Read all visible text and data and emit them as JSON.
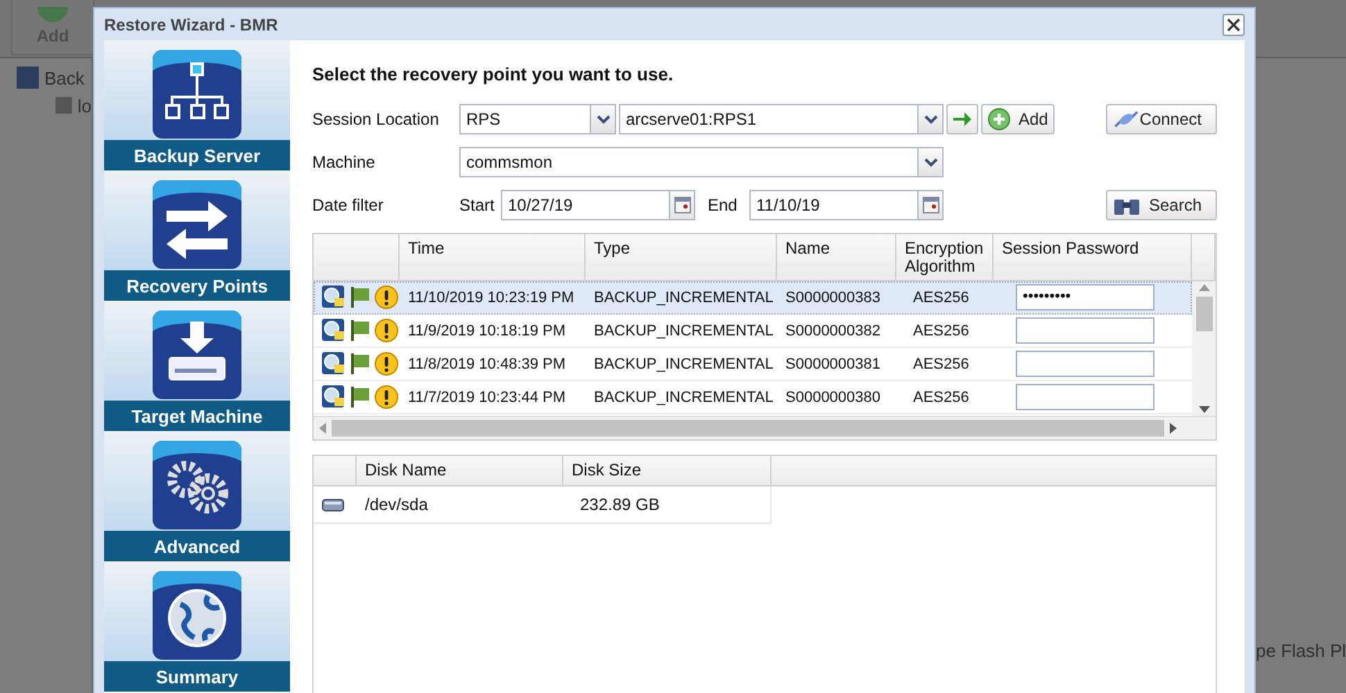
{
  "background": {
    "toolbar_button": "Add",
    "tree": [
      {
        "label": "Back",
        "children": [
          {
            "label": "lo"
          }
        ]
      }
    ],
    "side_text": "pe Flash Pl"
  },
  "dialog": {
    "title": "Restore Wizard - BMR"
  },
  "steps": [
    {
      "label": "Backup Server",
      "kind": "server"
    },
    {
      "label": "Recovery Points",
      "kind": "points"
    },
    {
      "label": "Target Machine",
      "kind": "target"
    },
    {
      "label": "Advanced",
      "kind": "advanced"
    },
    {
      "label": "Summary",
      "kind": "summary"
    }
  ],
  "heading": "Select the recovery point you want to use.",
  "session_location": {
    "label": "Session Location",
    "type": "RPS",
    "server": "arcserve01:RPS1",
    "add_button": "Add",
    "connect_button": "Connect"
  },
  "machine": {
    "label": "Machine",
    "value": "commsmon"
  },
  "date_filter": {
    "label": "Date filter",
    "start_label": "Start",
    "start": "10/27/19",
    "end_label": "End",
    "end": "11/10/19",
    "search_button": "Search"
  },
  "sessions": {
    "columns": [
      "Time",
      "Type",
      "Name",
      "Encryption Algorithm",
      "Session Password"
    ],
    "rows": [
      {
        "time": "11/10/2019 10:23:19 PM",
        "type": "BACKUP_INCREMENTAL",
        "name": "S0000000383",
        "encryption": "AES256",
        "password": "•••••••••",
        "selected": true
      },
      {
        "time": "11/9/2019 10:18:19 PM",
        "type": "BACKUP_INCREMENTAL",
        "name": "S0000000382",
        "encryption": "AES256",
        "selected": false
      },
      {
        "time": "11/8/2019 10:48:39 PM",
        "type": "BACKUP_INCREMENTAL",
        "name": "S0000000381",
        "encryption": "AES256",
        "selected": false
      },
      {
        "time": "11/7/2019 10:23:44 PM",
        "type": "BACKUP_INCREMENTAL",
        "name": "S0000000380",
        "encryption": "AES256",
        "selected": false
      }
    ]
  },
  "disks": {
    "columns": [
      "Disk Name",
      "Disk Size"
    ],
    "rows": [
      {
        "name": "/dev/sda",
        "size": "232.89 GB"
      }
    ]
  }
}
